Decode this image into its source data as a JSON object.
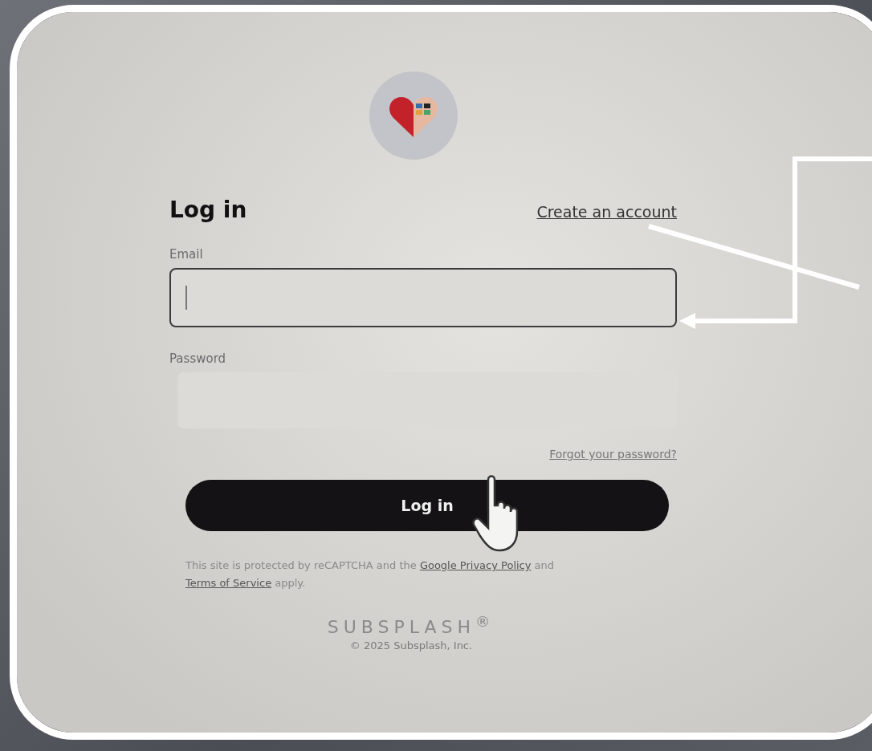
{
  "heading": "Log in",
  "create_account_link": "Create an account",
  "email": {
    "label": "Email",
    "focused": true
  },
  "password": {
    "label": "Password",
    "focused": false
  },
  "forgot_link": "Forgot your password?",
  "login_button": "Log in",
  "notice": [
    {
      "kind": "text",
      "text": "This site is protected by reCAPTCHA and the "
    },
    {
      "kind": "link",
      "text": "Google Privacy Policy"
    },
    {
      "kind": "text",
      "text": " and "
    },
    {
      "kind": "link",
      "text": "Terms of Service"
    },
    {
      "kind": "text",
      "text": " apply."
    }
  ],
  "brand": "SUBSPLASH$^{®}$",
  "copyright": "© 2025 Subsplash, Inc."
}
